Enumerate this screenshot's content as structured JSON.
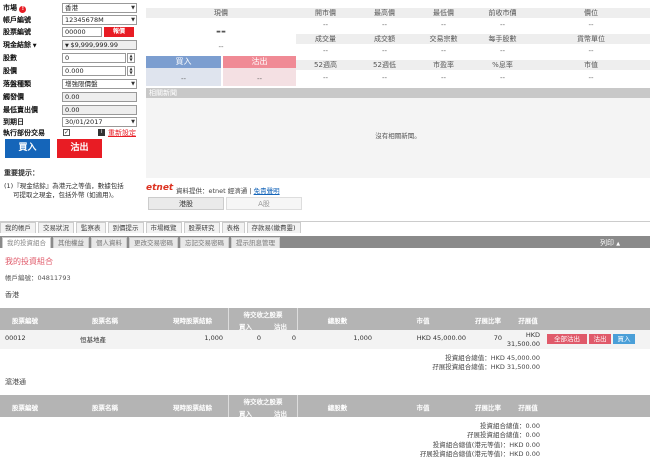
{
  "order": {
    "market_label": "市場",
    "market_value": "香港",
    "account_label": "帳戶編號",
    "account_value": "12345678M",
    "stock_code_label": "股票編號",
    "stock_code_value": "00000",
    "quote_button": "報價",
    "cash_label": "現金結餘",
    "cash_value": "$9,999,999.99",
    "qty_label": "股數",
    "qty_value": "0",
    "price_label": "股價",
    "price_value": "0.000",
    "order_type_label": "落盤種類",
    "order_type_value": "增強限價盤",
    "trigger_label": "觸發價",
    "trigger_value": "0.00",
    "max_sell_label": "最低賣出價",
    "max_sell_value": "0.00",
    "expiry_label": "到期日",
    "expiry_value": "30/01/2017",
    "odd_lot_label": "執行部份交易",
    "reset_link": "重新設定",
    "buy_button": "買入",
    "sell_button": "沽出"
  },
  "notice": {
    "title": "重要提示：",
    "line1": "(1)『現金結餘』為港元之等值，數據包括",
    "line2": "可提取之現金，包括外幣 (如適用)。"
  },
  "quote": {
    "h1": "現價",
    "h2": "開市價",
    "h3": "最高價",
    "h4": "最低價",
    "h5": "前收市價",
    "h6": "價位",
    "big_dash": "--",
    "small_dash": "--",
    "dash": "--",
    "h7": "成交量",
    "h8": "成交額",
    "h9": "交易宗數",
    "h10": "每手股數",
    "h11": "貨幣單位",
    "buy": "買入",
    "sell": "沽出",
    "h12": "52週高",
    "h13": "52週低",
    "h14": "市盈率",
    "h15": "%息率",
    "h16": "市值",
    "news_title": "相關新聞",
    "no_news": "沒有相關新聞。",
    "source_logo": "etnet",
    "source_text": "資料提供：etnet 經濟通",
    "disclaimer": "免責聲明",
    "tab_hk": "港股",
    "tab_a": "A股"
  },
  "tabs1": [
    "我的帳戶",
    "交易狀況",
    "監察表",
    "到價提示",
    "市場概覽",
    "股票研究",
    "表格",
    "存款易(繳費靈)"
  ],
  "tabs2": [
    "我的投資組合",
    "其他權益",
    "個人資料",
    "更改交易密碼",
    "忘記交易密碼",
    "提示訊息管理"
  ],
  "print_label": "列印",
  "portfolio": {
    "title": "我的投資組合",
    "account_line": "帳戶編號：04811793",
    "hk_section": "香港",
    "sh_section": "滬港通",
    "col_code": "股票編號",
    "col_name": "股票名稱",
    "col_avail": "現時股票結餘",
    "col_pending": "待交收之股票",
    "col_pending_buy": "買入",
    "col_pending_sell": "沽出",
    "col_total": "總股數",
    "col_market_value": "市值",
    "col_margin_ratio": "孖展比率",
    "col_margin_value": "孖展值",
    "row": {
      "code": "00012",
      "name": "恒基地產",
      "avail": "1,000",
      "buy": "0",
      "sell": "0",
      "total": "1,000",
      "mv": "HKD 45,000.00",
      "ratio": "70",
      "margin_cur": "HKD",
      "margin_val": "31,500.00"
    },
    "btn_sell_all": "全部沽出",
    "btn_sell": "沽出",
    "btn_buy": "買入",
    "hk_total1": "投資組合總值：HKD 45,000.00",
    "hk_total2": "孖展投資組合總值：HKD 31,500.00",
    "sh_total1": "投資組合總值：0.00",
    "sh_total2": "孖展投資組合總值：0.00",
    "sh_total3": "投資組合總值(港元等值)：HKD 0.00",
    "sh_total4": "孖展投資組合總值(港元等值)：HKD 0.00"
  },
  "colors": {
    "red": "#e81c24",
    "blue": "#1565b9",
    "header_gray": "#b4b4b4",
    "accent_pink": "#e05a6a"
  }
}
